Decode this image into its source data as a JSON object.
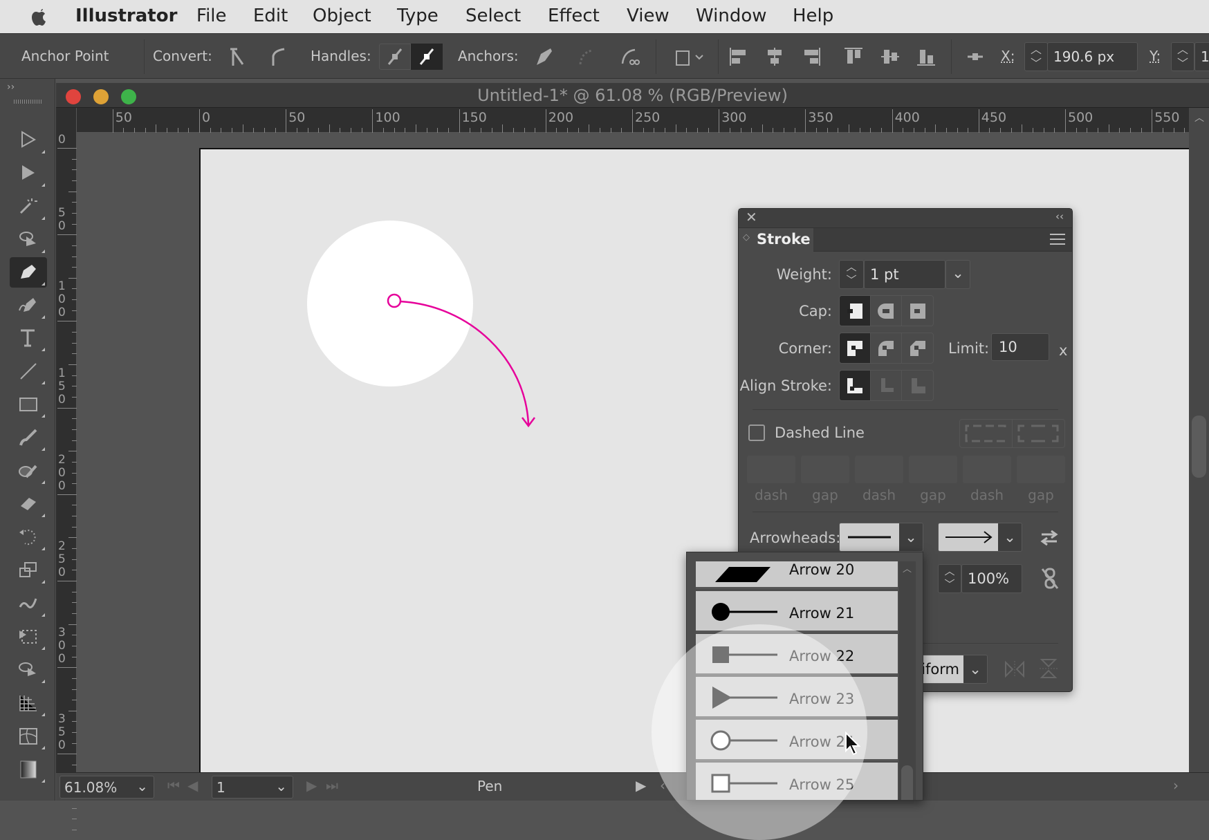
{
  "menubar": {
    "app": "Illustrator",
    "items": [
      "File",
      "Edit",
      "Object",
      "Type",
      "Select",
      "Effect",
      "View",
      "Window",
      "Help"
    ]
  },
  "toolbar": {
    "tool_name": "Anchor Point",
    "convert_label": "Convert:",
    "handles_label": "Handles:",
    "anchors_label": "Anchors:",
    "x_label": "X:",
    "x_value": "190.6 px",
    "y_label": "Y:",
    "y_value": "1"
  },
  "document": {
    "title": "Untitled-1* @ 61.08 % (RGB/Preview)"
  },
  "rulers": {
    "h": [
      "50",
      "0",
      "50",
      "100",
      "150",
      "200",
      "250",
      "300",
      "350",
      "400",
      "450",
      "500",
      "550"
    ],
    "v": [
      "0",
      "50",
      "100",
      "150",
      "200",
      "250",
      "300",
      "350"
    ]
  },
  "tools": [
    "selection",
    "direct-selection",
    "magic-wand",
    "lasso",
    "pen",
    "curvature",
    "type",
    "line-segment",
    "rectangle",
    "paintbrush",
    "shaper",
    "eraser",
    "rotate",
    "scale",
    "warp",
    "free-transform",
    "shape-builder",
    "perspective-grid",
    "mesh",
    "gradient"
  ],
  "active_tool": "pen",
  "stroke_panel": {
    "title": "Stroke",
    "weight_label": "Weight:",
    "weight_value": "1 pt",
    "cap_label": "Cap:",
    "corner_label": "Corner:",
    "limit_label": "Limit:",
    "limit_value": "10",
    "limit_unit": "x",
    "align_label": "Align Stroke:",
    "dashed_label": "Dashed Line",
    "dashed_checked": false,
    "dash_labels": [
      "dash",
      "gap",
      "dash",
      "gap",
      "dash",
      "gap"
    ],
    "arrowheads_label": "Arrowheads:",
    "scale_value": "100%",
    "align_value": "Uniform"
  },
  "arrow_dropdown": {
    "items": [
      "Arrow 20",
      "Arrow 21",
      "Arrow 22",
      "Arrow 23",
      "Arrow 24",
      "Arrow 25"
    ],
    "hovered": "Arrow 24"
  },
  "status": {
    "zoom": "61.08%",
    "artboard": "1",
    "tool": "Pen"
  },
  "colors": {
    "path": "#e6009a",
    "accent_active": "#282828"
  }
}
